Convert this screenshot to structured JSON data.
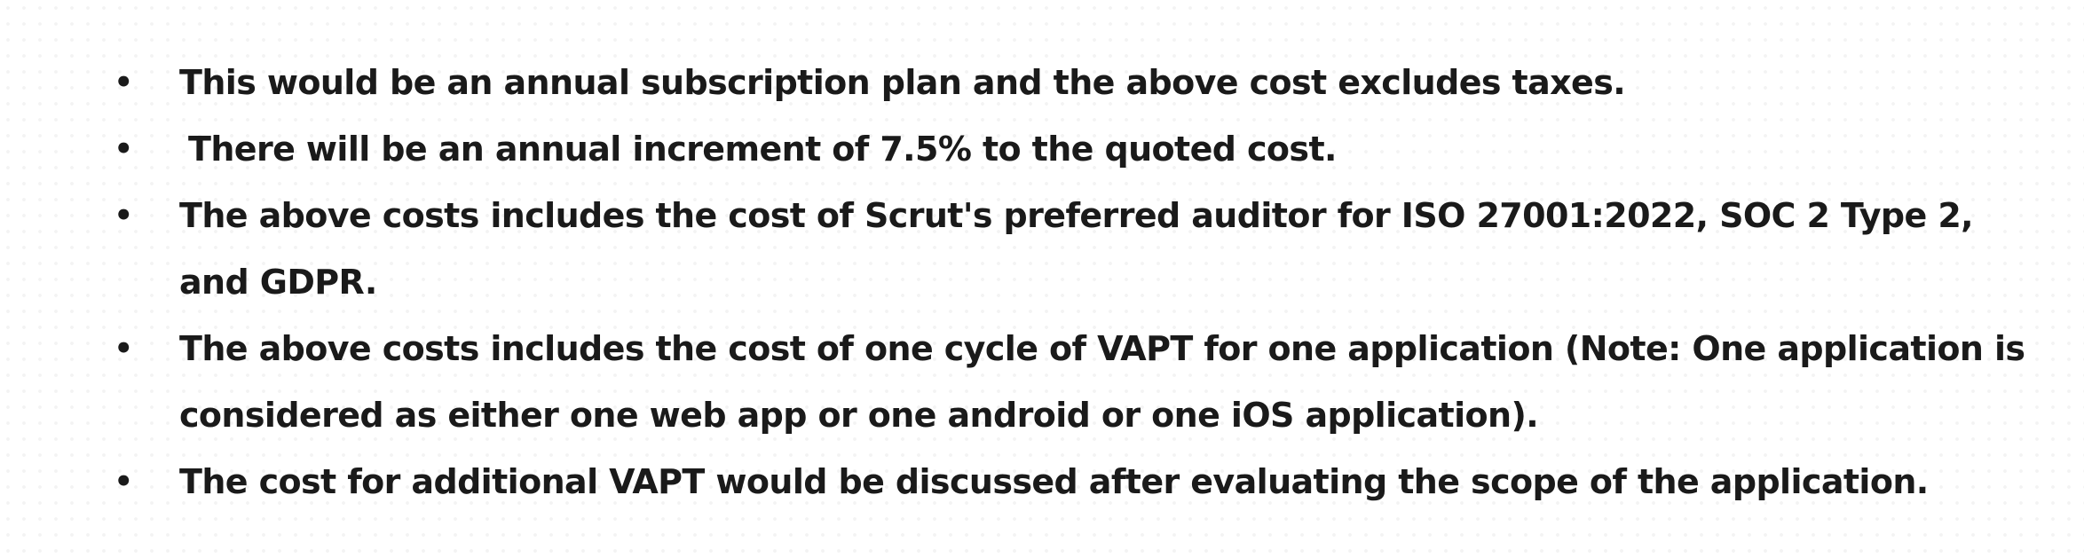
{
  "notes": {
    "bullet_symbol": "•",
    "items": [
      {
        "text": "This would be an annual subscription plan and the above cost excludes taxes."
      },
      {
        "text": "There will be an annual increment of 7.5% to the quoted cost."
      },
      {
        "text": "The above costs includes the cost of Scrut's preferred auditor for ISO 27001:2022, SOC 2 Type 2, and GDPR."
      },
      {
        "text": "The above costs includes the cost of one cycle of VAPT for one application (Note: One application is considered as either one web app or one android or one iOS application)."
      },
      {
        "text": "The cost for additional VAPT would be discussed after evaluating the scope of the application."
      }
    ]
  }
}
